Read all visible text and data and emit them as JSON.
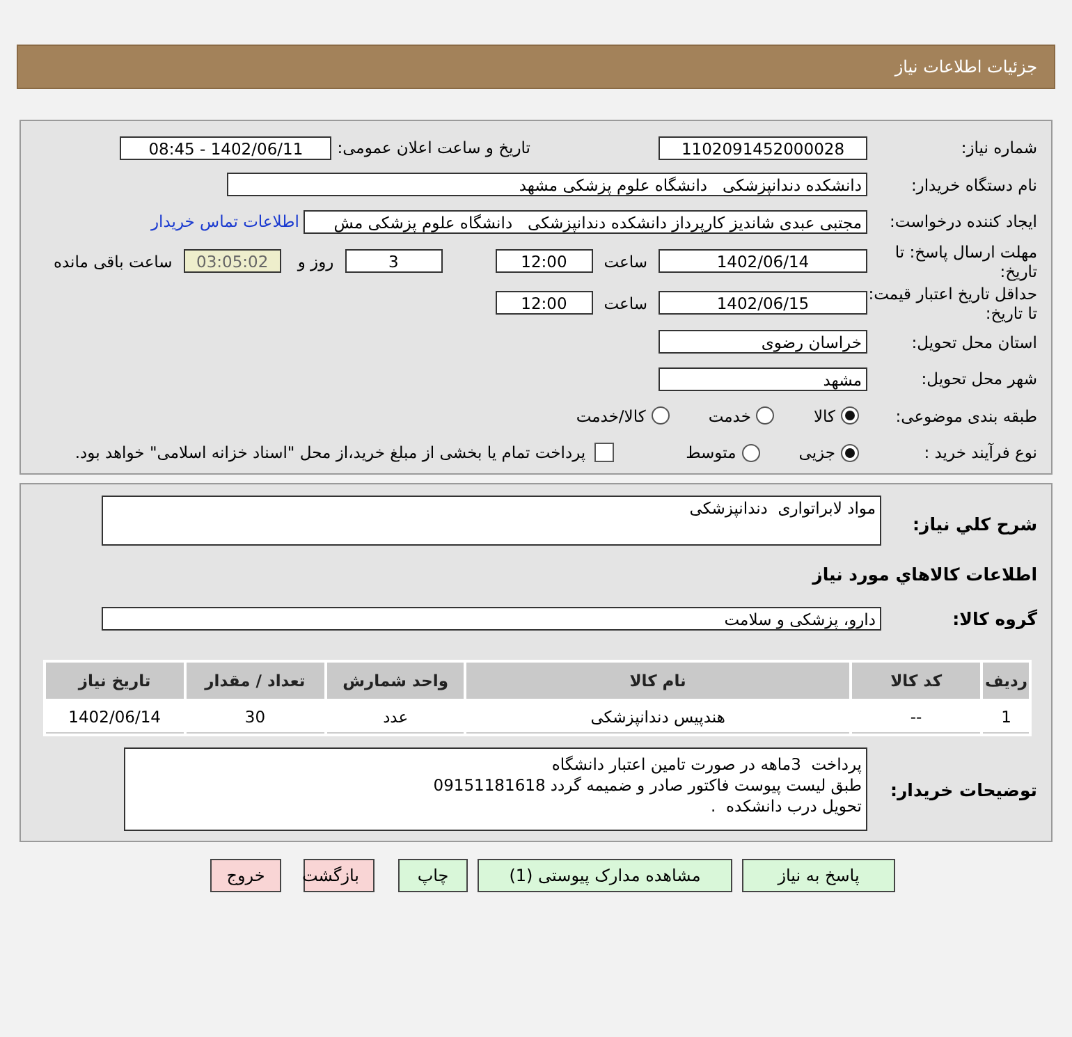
{
  "header": {
    "title": "جزئیات اطلاعات نیاز"
  },
  "details": {
    "need_number": {
      "label": "شماره نیاز:",
      "value": "1102091452000028"
    },
    "announce": {
      "label": "تاریخ و ساعت اعلان عمومی:",
      "value": "1402/06/11 - 08:45"
    },
    "buyer_org": {
      "label": "نام دستگاه خریدار:",
      "value": "دانشکده دندانپزشکی   دانشگاه علوم پزشکی مشهد"
    },
    "requester": {
      "label": "ایجاد کننده درخواست:",
      "value": "مجتبی عبدی شاندیز کارپرداز دانشکده دندانپزشکی   دانشگاه علوم پزشکی مش",
      "link": "اطلاعات تماس خریدار"
    },
    "deadline": {
      "label": "مهلت ارسال پاسخ: تا تاریخ:",
      "date": "1402/06/14",
      "time_label": "ساعت",
      "time": "12:00",
      "days": "3",
      "days_label": "روز و",
      "remaining": "03:05:02",
      "remaining_label": "ساعت باقی مانده"
    },
    "validity": {
      "label": "حداقل تاریخ اعتبار قیمت: تا تاریخ:",
      "date": "1402/06/15",
      "time_label": "ساعت",
      "time": "12:00"
    },
    "province": {
      "label": "استان محل تحویل:",
      "value": "خراسان رضوی"
    },
    "city": {
      "label": "شهر محل تحویل:",
      "value": "مشهد"
    },
    "category": {
      "label": "طبقه بندی موضوعی:",
      "options": [
        {
          "label": "کالا",
          "selected": true
        },
        {
          "label": "خدمت",
          "selected": false
        },
        {
          "label": "کالا/خدمت",
          "selected": false
        }
      ]
    },
    "process": {
      "label": "نوع فرآیند خرید :",
      "options": [
        {
          "label": "جزیی",
          "selected": true
        },
        {
          "label": "متوسط",
          "selected": false
        }
      ],
      "treasury": {
        "label": "پرداخت تمام یا بخشی از مبلغ خرید،از محل \"اسناد خزانه اسلامی\" خواهد بود.",
        "checked": false
      }
    }
  },
  "items": {
    "summary": {
      "label": "شرح کلي نياز:",
      "value": "مواد لابراتواری  دندانپزشکی"
    },
    "section_title": "اطلاعات کالاهاي مورد نياز",
    "group": {
      "label": "گروه کالا:",
      "value": "دارو، پزشکی و سلامت"
    },
    "table": {
      "columns": [
        "ردیف",
        "کد کالا",
        "نام کالا",
        "واحد شمارش",
        "تعداد / مقدار",
        "تاریخ نیاز"
      ],
      "rows": [
        [
          "1",
          "--",
          "هندپیس دندانپزشکی",
          "عدد",
          "30",
          "1402/06/14"
        ]
      ]
    },
    "notes": {
      "label": "توضیحات خریدار:",
      "lines": [
        "پرداخت  3ماهه در صورت تامین اعتبار دانشگاه",
        "طبق لیست پیوست فاکتور صادر و ضمیمه گردد 09151181618",
        "تحویل درب دانشکده  ."
      ]
    }
  },
  "buttons": [
    {
      "label": "پاسخ به نیاز",
      "kind": "action"
    },
    {
      "label": "مشاهده مدارک پیوستی (1)",
      "kind": "action"
    },
    {
      "label": "چاپ",
      "kind": "action"
    },
    {
      "label": "بازگشت",
      "kind": "cancel"
    },
    {
      "label": "خروج",
      "kind": "cancel"
    }
  ]
}
